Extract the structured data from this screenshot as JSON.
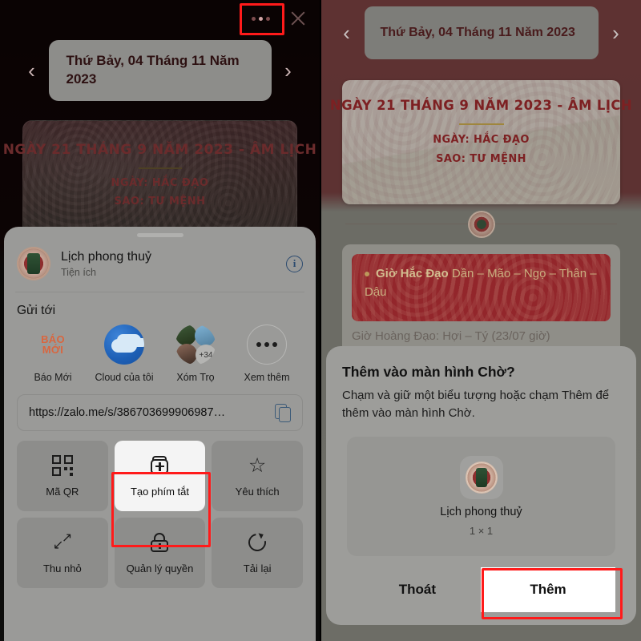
{
  "left_panel": {
    "topbar": {
      "menu_icon": "more-horizontal-icon",
      "close_icon": "close-icon"
    },
    "date_header": {
      "prev_icon": "chevron-left-icon",
      "next_icon": "chevron-right-icon",
      "text": "Thứ Bảy, 04 Tháng 11 Năm 2023"
    },
    "lunar_card": {
      "title": "NGÀY 21 THÁNG 9 NĂM 2023  - ÂM LỊCH",
      "line1": "NGÀY: HẮC ĐẠO",
      "line2": "SAO: TƯ MỆNH"
    },
    "share_sheet": {
      "app_name": "Lịch phong thuỷ",
      "app_category": "Tiện ích",
      "info_icon": "info-icon",
      "app_icon": "app-medallion-icon",
      "send_to_label": "Gửi tới",
      "targets": [
        {
          "label": "Báo Mới",
          "icon": "baomoi-icon",
          "line1": "BÁO",
          "line2": "MỚI"
        },
        {
          "label": "Cloud của tôi",
          "icon": "cloud-icon"
        },
        {
          "label": "Xóm Trọ",
          "icon": "group-avatars-icon",
          "badge": "+34"
        },
        {
          "label": "Xem thêm",
          "icon": "more-dots-icon"
        }
      ],
      "url": "https://zalo.me/s/386703699906987…",
      "copy_icon": "copy-icon",
      "actions": [
        {
          "label": "Mã QR",
          "icon": "qr-code-icon",
          "highlighted": false
        },
        {
          "label": "Tạo phím tắt",
          "icon": "add-shortcut-icon",
          "highlighted": true
        },
        {
          "label": "Yêu thích",
          "icon": "star-icon",
          "highlighted": false
        },
        {
          "label": "Thu nhỏ",
          "icon": "minimize-icon",
          "highlighted": false
        },
        {
          "label": "Quản lý quyền",
          "icon": "lock-icon",
          "highlighted": false
        },
        {
          "label": "Tải lại",
          "icon": "reload-icon",
          "highlighted": false
        }
      ]
    }
  },
  "right_panel": {
    "date_header": {
      "prev_icon": "chevron-left-icon",
      "next_icon": "chevron-right-icon",
      "text": "Thứ Bảy, 04 Tháng 11 Năm 2023"
    },
    "lunar_card": {
      "title": "NGÀY 21 THÁNG 9 NĂM 2023  - ÂM LỊCH",
      "line1": "NGÀY: HẮC ĐẠO",
      "line2": "SAO: TƯ MỆNH"
    },
    "seal_icon": "seal-medallion-icon",
    "hour_card": {
      "label": "Giờ Hắc Đạo",
      "value": " Dần – Mão – Ngọ – Thân – Dậu",
      "faded_line": "Giờ Hoàng Đạo: Hợi – Tý (23/07 giờ)"
    },
    "dialog": {
      "title": "Thêm vào màn hình Chờ?",
      "body": "Chạm và giữ một biểu tượng hoặc chạm Thêm để thêm vào màn hình Chờ.",
      "widget_icon": "app-medallion-icon",
      "widget_name": "Lịch phong thuỷ",
      "widget_size": "1 × 1",
      "cancel_label": "Thoát",
      "confirm_label": "Thêm"
    }
  },
  "annotations": {
    "highlight_color": "#ff1a1a",
    "boxes": [
      "menu-button",
      "tao-phim-tat-action",
      "them-button"
    ]
  }
}
